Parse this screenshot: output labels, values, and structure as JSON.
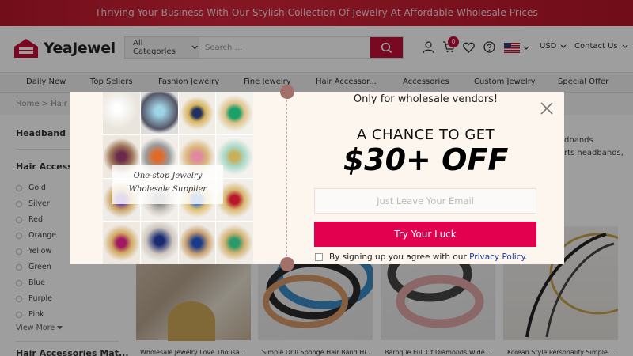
{
  "promo": {
    "text": "Thriving Your Business With Our Stylish Collection Of Jewelry At Affordable Wholesale Prices"
  },
  "header": {
    "logo_text": "YeaJewel",
    "category_select": "All Categories",
    "search_placeholder": "Search ...",
    "cart_count": "0",
    "currency": "USD",
    "contact": "Contact Us"
  },
  "nav": {
    "items": [
      "Daily New",
      "Top Sellers",
      "Fashion Jewelry",
      "Fine Jewelry",
      "Hair Accessor...",
      "Accessories",
      "Custom Jewelry",
      "Special Offer"
    ]
  },
  "breadcrumb": {
    "text": "Home > Hair Ac"
  },
  "sidebar": {
    "heading1": "Headband",
    "heading2": "Hair Accesso",
    "colors": [
      "Gold",
      "Silver",
      "Red",
      "Orange",
      "Yellow",
      "Green",
      "Blue",
      "Purple",
      "Pink"
    ],
    "view_more": "View More",
    "heading3": "Hair Accessories Mat..."
  },
  "right_text": {
    "line1": "dbands",
    "line2": "rts headbands,"
  },
  "products": [
    {
      "title": "Wholesale Jewelry Love Thousa..."
    },
    {
      "title": "Simple Drill Sponge Hair Band Hi..."
    },
    {
      "title": "Baroque Full Of Diamonds Wide ..."
    },
    {
      "title": "Korean Style Personality Simple ..."
    }
  ],
  "modal": {
    "heading": "Only for wholesale vendors!",
    "chance": "A CHANCE TO GET",
    "offer": "$30+ OFF",
    "email_placeholder": "Just Leave Your Email",
    "button": "Try Your Luck",
    "terms_prefix": "By signing up you agree with our ",
    "terms_link": "Privacy Policy.",
    "caption_line1": "One-stop Jewelry",
    "caption_line2": "Wholesale Supplier"
  },
  "colors": {
    "brand": "#c40f37",
    "button": "#e2004f",
    "promo_bg": "#c91e33"
  }
}
